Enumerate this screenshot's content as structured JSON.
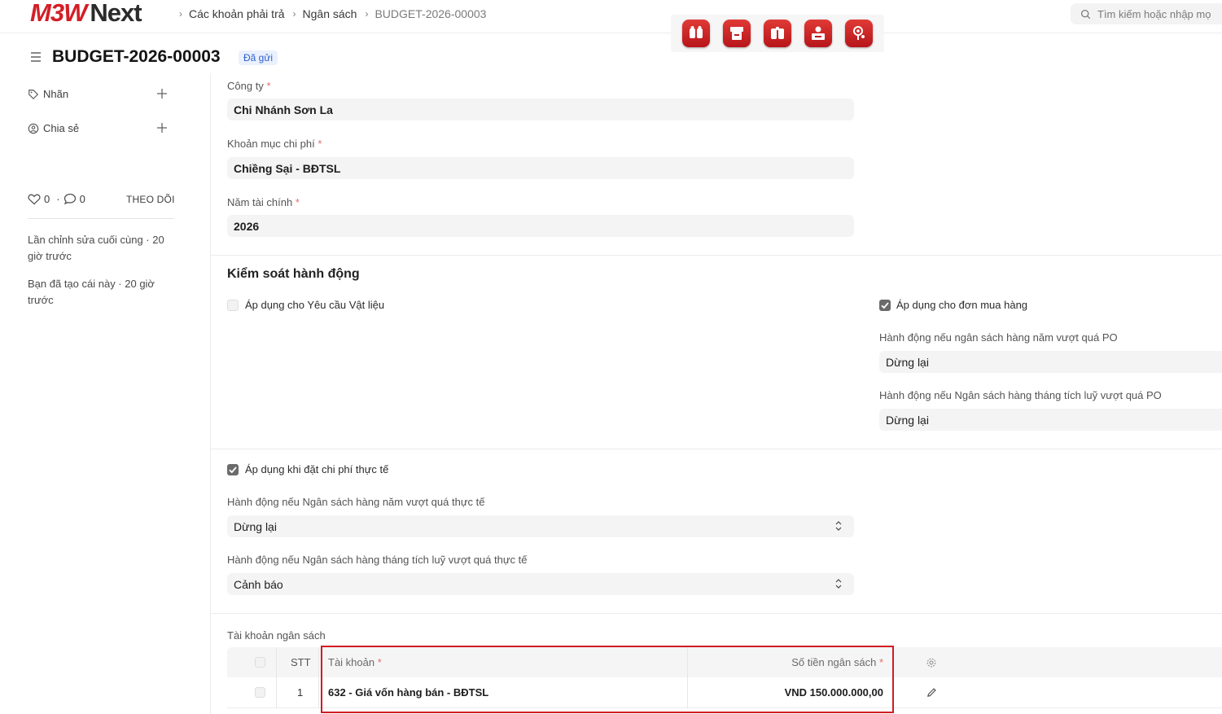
{
  "brand": {
    "logo_left": "M3W",
    "logo_right": "Next"
  },
  "breadcrumb": [
    "Các khoản phải trả",
    "Ngân sách",
    "BUDGET-2026-00003"
  ],
  "search": {
    "placeholder": "Tìm kiếm hoặc nhập mọ"
  },
  "app_shortcuts": [
    "app-shortcut-1",
    "app-shortcut-2",
    "app-shortcut-3",
    "app-shortcut-4",
    "app-shortcut-5"
  ],
  "header": {
    "title": "BUDGET-2026-00003",
    "status": "Đã gửi"
  },
  "sidebar": {
    "tags_label": "Nhãn",
    "share_label": "Chia sẻ",
    "likes": "0",
    "comments": "0",
    "follow_label": "THEO DÕI",
    "last_edited": "Lần chỉnh sửa cuối cùng · 20 giờ trước",
    "created": "Bạn đã tạo cái này · 20 giờ trước"
  },
  "form": {
    "company": {
      "label": "Công ty",
      "value": "Chi Nhánh Sơn La"
    },
    "cost_center": {
      "label": "Khoản mục chi phí",
      "value": "Chiềng Sại - BĐTSL"
    },
    "fiscal_year": {
      "label": "Năm tài chính",
      "value": "2026"
    }
  },
  "action_control": {
    "title": "Kiểm soát hành động",
    "material_request": {
      "label": "Áp dụng cho Yêu cầu Vật liệu",
      "checked": false
    },
    "purchase_order": {
      "label": "Áp dụng cho đơn mua hàng",
      "checked": true
    },
    "po_annual": {
      "label": "Hành động nếu ngân sách hàng năm vượt quá PO",
      "value": "Dừng lại"
    },
    "po_monthly": {
      "label": "Hành động nếu Ngân sách hàng tháng tích luỹ vượt quá PO",
      "value": "Dừng lại"
    },
    "actual_expense": {
      "label": "Áp dụng khi đặt chi phí thực tế",
      "checked": true
    },
    "actual_annual": {
      "label": "Hành động nếu Ngân sách hàng năm vượt quá thực tế",
      "value": "Dừng lại"
    },
    "actual_monthly": {
      "label": "Hành động nếu Ngân sách hàng tháng tích luỹ vượt quá thực tế",
      "value": "Cảnh báo"
    }
  },
  "budget_accounts": {
    "label": "Tài khoản ngân sách",
    "columns": {
      "no": "STT",
      "account": "Tài khoản",
      "amount": "Số tiền ngân sách"
    },
    "rows": [
      {
        "no": "1",
        "account": "632 - Giá vốn hàng bán - BĐTSL",
        "amount": "VND 150.000.000,00"
      }
    ]
  },
  "colors": {
    "brand_red": "#d31f26",
    "highlight_border": "#d01c24",
    "status_blue": "#2b5fce"
  }
}
